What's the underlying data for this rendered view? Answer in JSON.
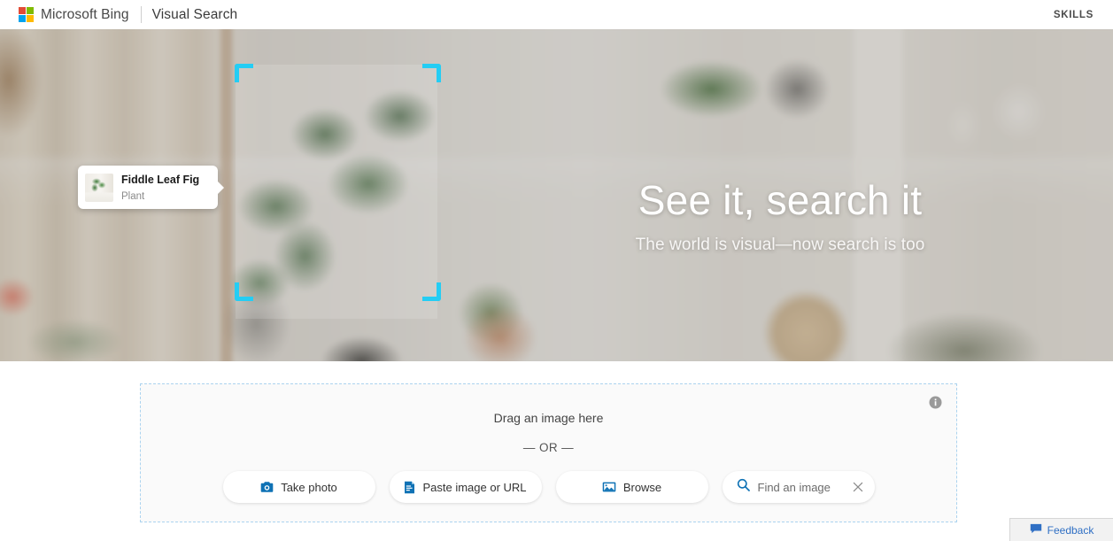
{
  "header": {
    "brand": "Microsoft Bing",
    "divider": "|",
    "subtitle": "Visual Search",
    "skills_label": "SKILLS",
    "logo_icon": "microsoft-logo-icon",
    "logo_colors": {
      "top_left": "#e24b36",
      "top_right": "#80bb00",
      "bottom_left": "#00a3ee",
      "bottom_right": "#ffba00"
    }
  },
  "hero": {
    "title": "See it, search it",
    "subtitle": "The world is visual—now search is too",
    "selection_color": "#24cdf4",
    "entity_card": {
      "title": "Fiddle Leaf Fig",
      "subtitle": "Plant",
      "thumb_icon": "plant-thumbnail-icon"
    }
  },
  "dropzone": {
    "drag_label": "Drag an image here",
    "or_label": "— OR —",
    "border_color": "#abd3ef",
    "info_icon": "info-icon",
    "actions": [
      {
        "label": "Take photo",
        "icon": "camera-icon"
      },
      {
        "label": "Paste image or URL",
        "icon": "paste-document-icon"
      },
      {
        "label": "Browse",
        "icon": "image-browse-icon"
      }
    ],
    "search": {
      "placeholder": "Find an image",
      "value": "",
      "search_icon": "search-icon",
      "clear_icon": "close-icon"
    },
    "accent_color": "#0f72b5"
  },
  "feedback": {
    "label": "Feedback",
    "icon": "feedback-speech-bubble-icon",
    "color": "#2f6fc4"
  }
}
